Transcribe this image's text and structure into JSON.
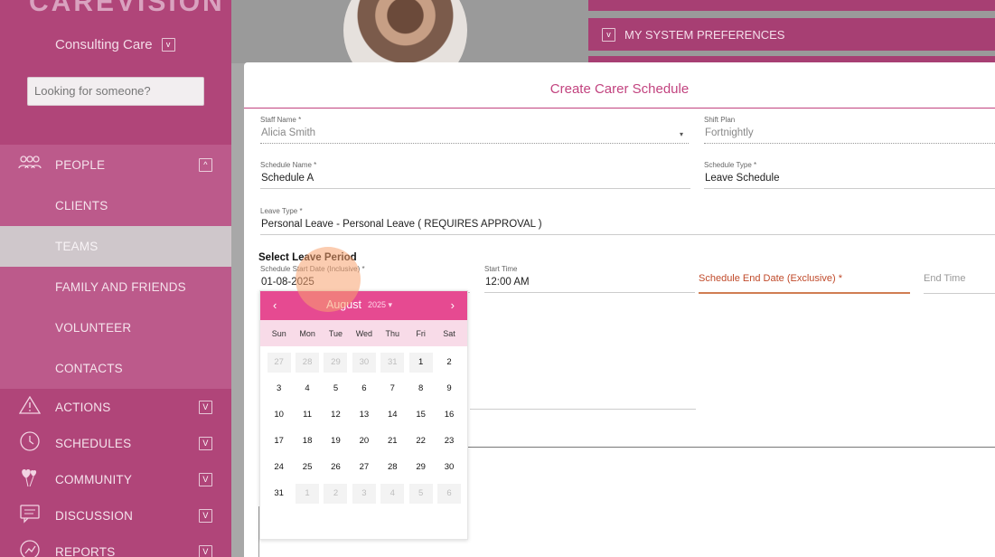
{
  "sidebar": {
    "brand": "CAREVISION",
    "org_name": "Consulting Care",
    "search_placeholder": "Looking for someone?",
    "people": {
      "label": "PEOPLE",
      "icon": "people-icon",
      "expanded_marker": "^"
    },
    "sub_items": [
      {
        "label": "CLIENTS"
      },
      {
        "label": "TEAMS",
        "active": true
      },
      {
        "label": "FAMILY AND FRIENDS"
      },
      {
        "label": "VOLUNTEER"
      },
      {
        "label": "CONTACTS"
      }
    ],
    "main_items": [
      {
        "label": "ACTIONS",
        "icon": "warning-triangle-icon"
      },
      {
        "label": "SCHEDULES",
        "icon": "clock-icon"
      },
      {
        "label": "COMMUNITY",
        "icon": "heart-balloons-icon"
      },
      {
        "label": "DISCUSSION",
        "icon": "chat-icon"
      },
      {
        "label": "REPORTS",
        "icon": "reports-icon"
      }
    ],
    "expand_marker": "v"
  },
  "background": {
    "preferences_label": "MY SYSTEM PREFERENCES"
  },
  "modal": {
    "title": "Create Carer Schedule",
    "fields": {
      "staff_name": {
        "label": "Staff Name *",
        "value": "Alicia Smith"
      },
      "shift_plan": {
        "label": "Shift Plan",
        "value": "Fortnightly"
      },
      "schedule_name": {
        "label": "Schedule Name *",
        "value": "Schedule A"
      },
      "schedule_type": {
        "label": "Schedule Type *",
        "value": "Leave Schedule"
      },
      "leave_type": {
        "label": "Leave Type *",
        "value": "Personal Leave - Personal Leave ( REQUIRES APPROVAL )"
      },
      "start_date": {
        "label": "Schedule Start Date (Inclusive) *",
        "value": "01-08-2025"
      },
      "start_time": {
        "label": "Start Time",
        "value": "12:00 AM"
      },
      "end_date": {
        "label": "Schedule End Date (Exclusive) *"
      },
      "end_time": {
        "label": "End Time"
      }
    },
    "section_title": "Select Leave Period"
  },
  "calendar": {
    "month": "August",
    "year": "2025",
    "prev": "‹",
    "next": "›",
    "year_caret": "▾",
    "weekdays": [
      "Sun",
      "Mon",
      "Tue",
      "Wed",
      "Thu",
      "Fri",
      "Sat"
    ],
    "days": [
      {
        "d": "27",
        "other": true
      },
      {
        "d": "28",
        "other": true
      },
      {
        "d": "29",
        "other": true
      },
      {
        "d": "30",
        "other": true
      },
      {
        "d": "31",
        "other": true
      },
      {
        "d": "1",
        "first": true
      },
      {
        "d": "2"
      },
      {
        "d": "3"
      },
      {
        "d": "4"
      },
      {
        "d": "5"
      },
      {
        "d": "6"
      },
      {
        "d": "7"
      },
      {
        "d": "8"
      },
      {
        "d": "9"
      },
      {
        "d": "10"
      },
      {
        "d": "11"
      },
      {
        "d": "12"
      },
      {
        "d": "13"
      },
      {
        "d": "14"
      },
      {
        "d": "15"
      },
      {
        "d": "16"
      },
      {
        "d": "17"
      },
      {
        "d": "18"
      },
      {
        "d": "19"
      },
      {
        "d": "20"
      },
      {
        "d": "21"
      },
      {
        "d": "22"
      },
      {
        "d": "23"
      },
      {
        "d": "24"
      },
      {
        "d": "25"
      },
      {
        "d": "26"
      },
      {
        "d": "27"
      },
      {
        "d": "28"
      },
      {
        "d": "29"
      },
      {
        "d": "30"
      },
      {
        "d": "31"
      },
      {
        "d": "1",
        "other": true
      },
      {
        "d": "2",
        "other": true
      },
      {
        "d": "3",
        "other": true
      },
      {
        "d": "4",
        "other": true
      },
      {
        "d": "5",
        "other": true
      },
      {
        "d": "6",
        "other": true
      }
    ]
  },
  "colors": {
    "sidebar": "#b04579",
    "accent": "#c2437f",
    "calendar_header": "#e64a91",
    "error": "#c04a2a"
  }
}
